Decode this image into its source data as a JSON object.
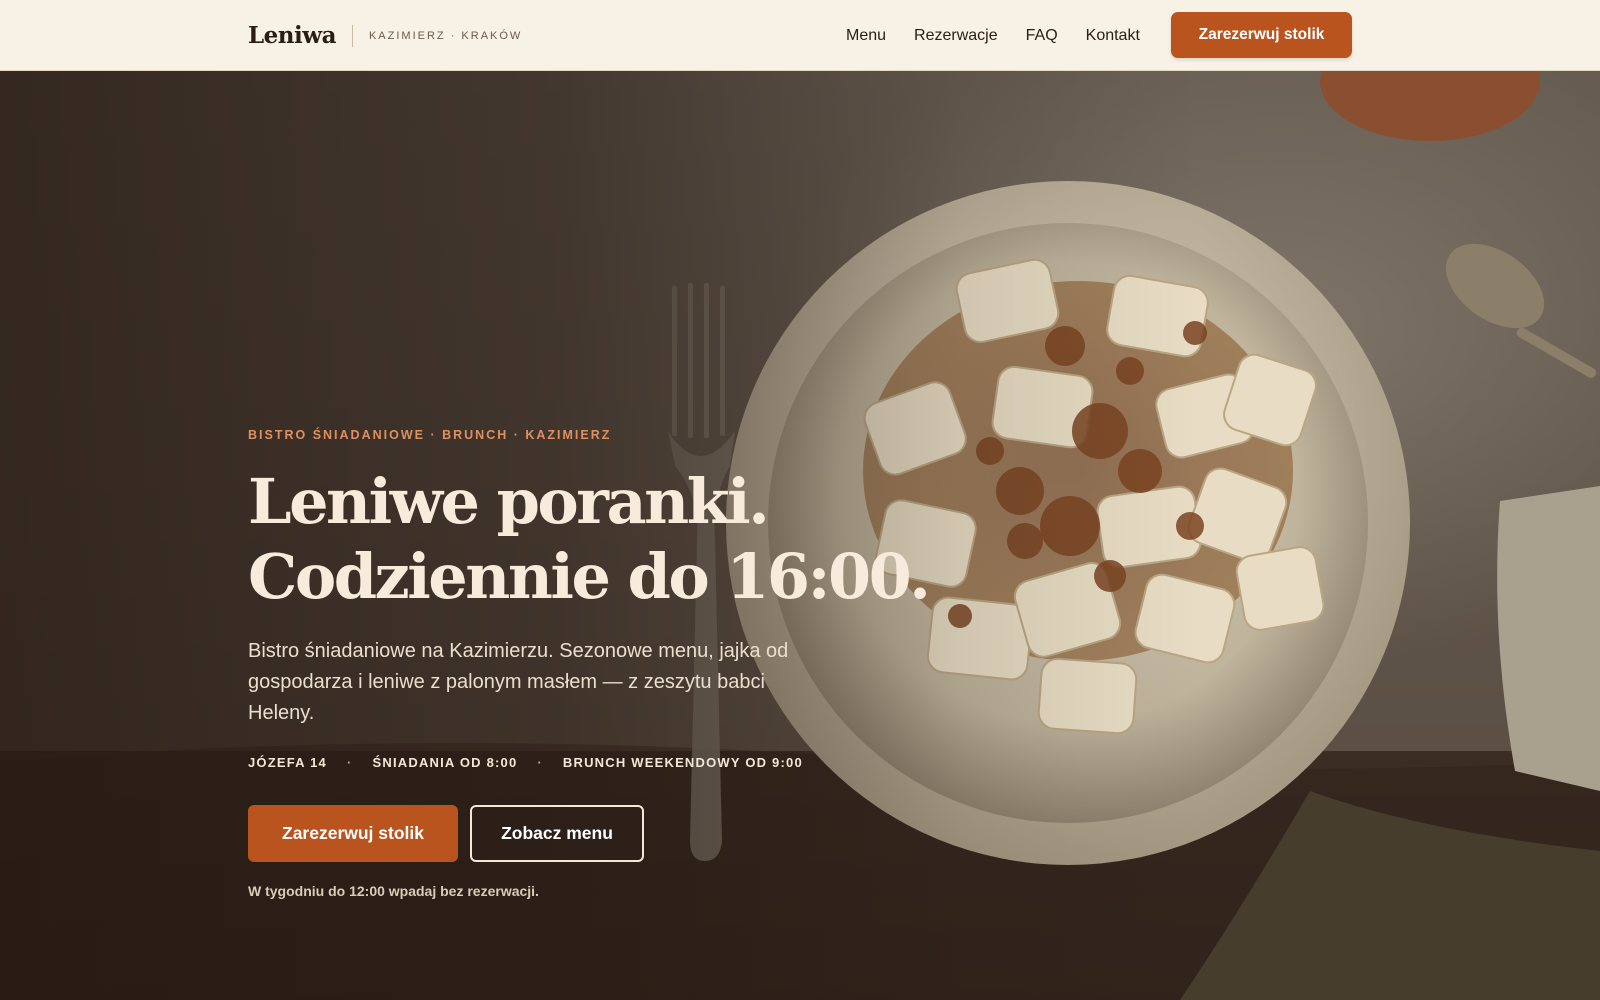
{
  "header": {
    "brand_name": "Leniwa",
    "brand_location": "KAZIMIERZ · KRAKÓW",
    "nav": [
      {
        "label": "Menu"
      },
      {
        "label": "Rezerwacje"
      },
      {
        "label": "FAQ"
      },
      {
        "label": "Kontakt"
      }
    ],
    "cta_label": "Zarezerwuj stolik"
  },
  "hero": {
    "eyebrow": "BISTRO ŚNIADANIOWE · BRUNCH · KAZIMIERZ",
    "headline_line1": "Leniwe poranki.",
    "headline_line2": "Codziennie do 16:00.",
    "lede": "Bistro śniadaniowe na Kazimierzu. Sezonowe menu, jajka od gospodarza i leniwe z palonym masłem — z zeszytu babci Heleny.",
    "meta": [
      "JÓZEFA 14",
      "ŚNIADANIA OD 8:00",
      "BRUNCH WEEKENDOWY OD 9:00"
    ],
    "meta_separator": "·",
    "primary_button": "Zarezerwuj stolik",
    "secondary_button": "Zobacz menu",
    "note": "W tygodniu do 12:00 wpadaj bez rezerwacji."
  },
  "colors": {
    "accent": "#b9541f",
    "header_bg": "#f8f1e5",
    "headline_text": "#f7ecdb",
    "eyebrow_text": "#e09060"
  }
}
